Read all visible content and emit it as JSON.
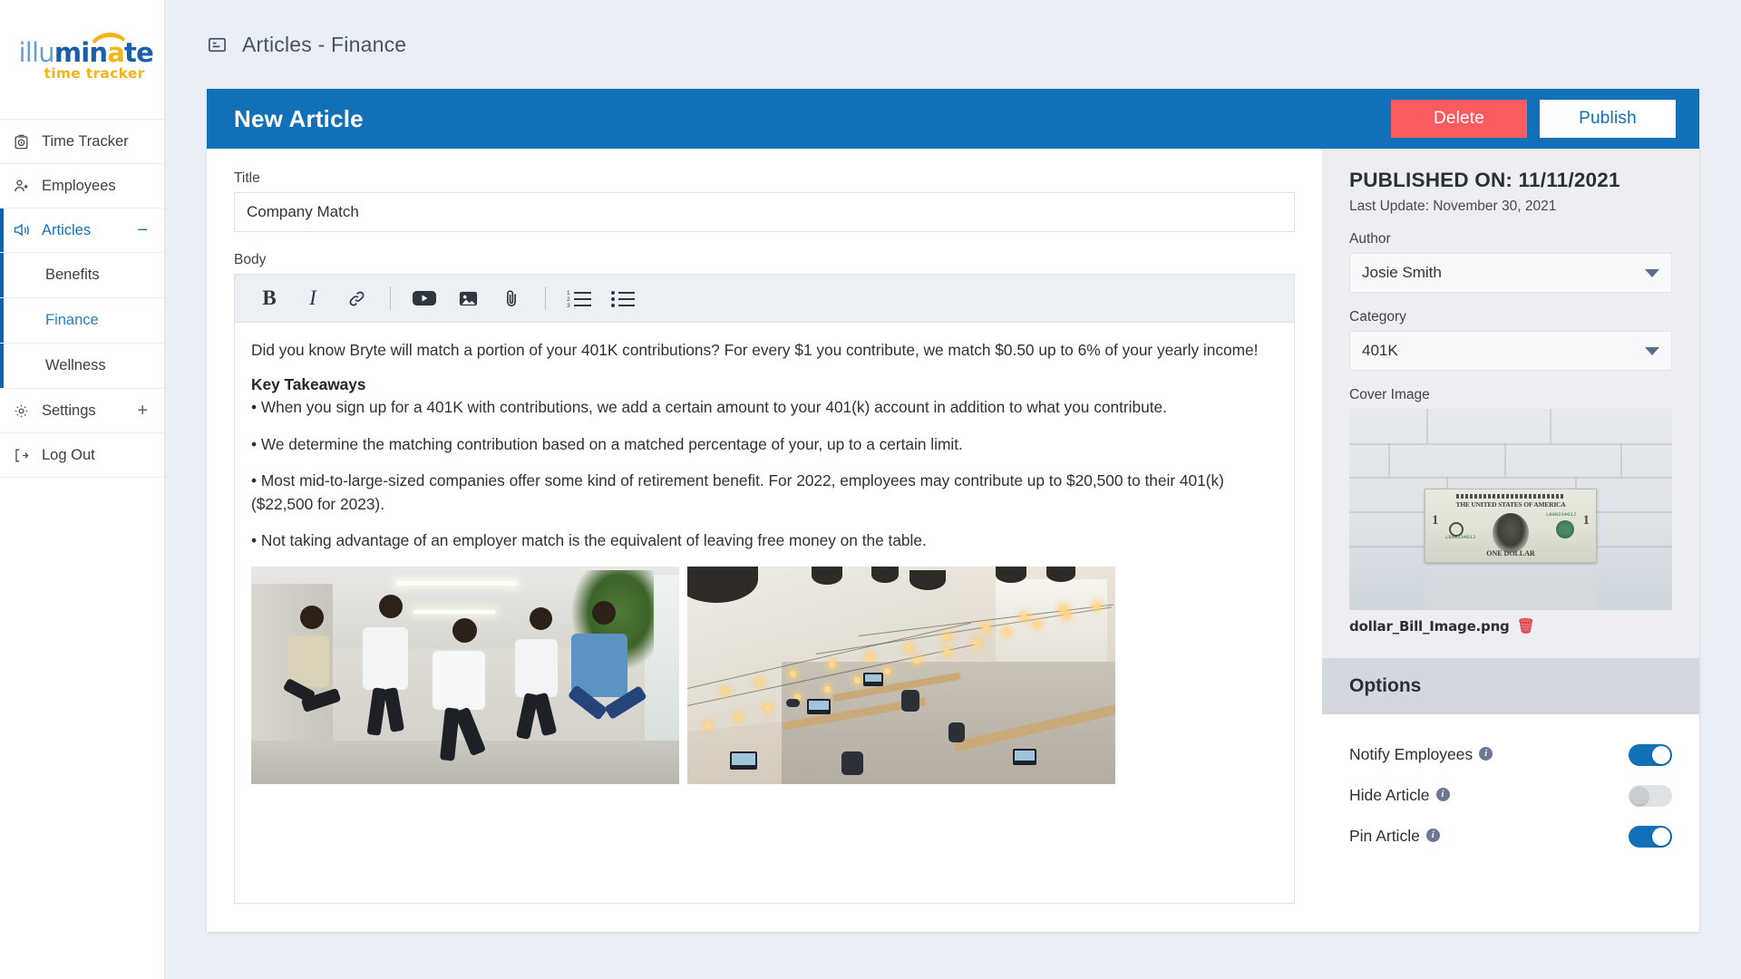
{
  "sidebar": {
    "logo": {
      "part1": "illu",
      "part2": "min",
      "part3": "a",
      "part4": "te",
      "sub": "time tracker"
    },
    "items": [
      {
        "label": "Time Tracker",
        "icon": "timer-icon"
      },
      {
        "label": "Employees",
        "icon": "employees-icon"
      },
      {
        "label": "Articles",
        "icon": "megaphone-icon",
        "expander": "−"
      },
      {
        "label": "Settings",
        "icon": "gear-icon",
        "expander": "+"
      },
      {
        "label": "Log Out",
        "icon": "logout-icon"
      }
    ],
    "sub_items": [
      {
        "label": "Benefits"
      },
      {
        "label": "Finance"
      },
      {
        "label": "Wellness"
      }
    ]
  },
  "topbar": {
    "icon": "article-card-icon",
    "title": "Articles - Finance"
  },
  "card": {
    "header_title": "New Article",
    "delete_label": "Delete",
    "publish_label": "Publish"
  },
  "editor": {
    "title_label": "Title",
    "title_value": "Company Match",
    "title_placeholder": "Title",
    "body_label": "Body",
    "toolbar": [
      {
        "name": "bold-icon",
        "glyph": "B"
      },
      {
        "name": "italic-icon",
        "glyph": "I"
      },
      {
        "name": "link-icon",
        "glyph": "link"
      },
      {
        "name": "divider",
        "glyph": "|"
      },
      {
        "name": "video-icon",
        "glyph": "video"
      },
      {
        "name": "image-icon",
        "glyph": "image"
      },
      {
        "name": "attachment-icon",
        "glyph": "paperclip"
      },
      {
        "name": "divider",
        "glyph": "|"
      },
      {
        "name": "numbered-list-icon",
        "glyph": "ol"
      },
      {
        "name": "bullet-list-icon",
        "glyph": "ul"
      }
    ],
    "content": {
      "intro": "Did you know Bryte will match a portion of your 401K contributions? For every $1 you contribute, we match $0.50 up to 6% of your yearly income!",
      "heading": "Key Takeaways",
      "bullets": [
        "• When you sign up for a 401K with contributions, we add a certain amount to your 401(k) account in addition to what you contribute.",
        "• We determine the matching contribution based on a matched percentage of your, up to a certain limit.",
        "• Most mid-to-large-sized companies offer some kind of retirement benefit. For 2022, employees may contribute up to $20,500 to their 401(k) ($22,500 for 2023).",
        "• Not taking advantage of an employer match is the equivalent of leaving free money on the table."
      ],
      "images": [
        {
          "name": "body-image-jumping-employees",
          "alt": "Five people jumping in an office hallway"
        },
        {
          "name": "body-image-open-office",
          "alt": "Open plan office with string lights"
        }
      ]
    }
  },
  "side_panel": {
    "published_on": "PUBLISHED ON: 11/11/2021",
    "last_update": "Last Update: November 30, 2021",
    "author_label": "Author",
    "author_value": "Josie Smith",
    "category_label": "Category",
    "category_value": "401K",
    "cover_image_label": "Cover Image",
    "cover_image_name": "dollar_Bill_Image.png",
    "cover_image_alt": "One US dollar bill against a white brick wall with reflection",
    "delete_cover_icon": "trash-icon",
    "options_title": "Options",
    "options": [
      {
        "label": "Notify Employees",
        "state": "on"
      },
      {
        "label": "Hide Article",
        "state": "off"
      },
      {
        "label": "Pin Article",
        "state": "on"
      }
    ]
  },
  "colors": {
    "brand_blue": "#1270b8",
    "delete_red": "#fa5b5f",
    "accent_yellow": "#f5b51a",
    "page_bg": "#eaeff7",
    "panel_bg": "#eceef2"
  }
}
